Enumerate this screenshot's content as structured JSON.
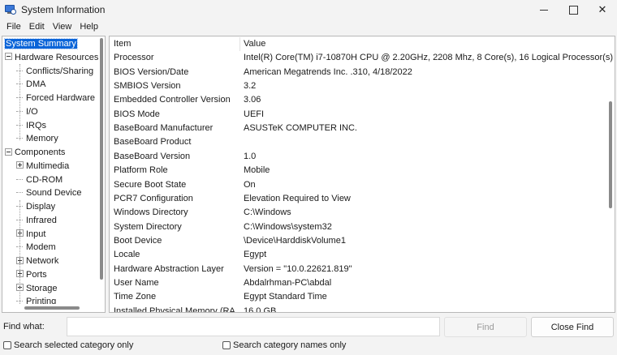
{
  "window": {
    "title": "System Information",
    "icon": "system-info-icon"
  },
  "menu": [
    "File",
    "Edit",
    "View",
    "Help"
  ],
  "tree": {
    "items": [
      {
        "label": "System Summary",
        "level": 0,
        "selected": true,
        "expander": "none"
      },
      {
        "label": "Hardware Resources",
        "level": 0,
        "expander": "minus"
      },
      {
        "label": "Conflicts/Sharing",
        "level": 1,
        "expander": "none"
      },
      {
        "label": "DMA",
        "level": 1,
        "expander": "none"
      },
      {
        "label": "Forced Hardware",
        "level": 1,
        "expander": "none"
      },
      {
        "label": "I/O",
        "level": 1,
        "expander": "none"
      },
      {
        "label": "IRQs",
        "level": 1,
        "expander": "none"
      },
      {
        "label": "Memory",
        "level": 1,
        "expander": "none"
      },
      {
        "label": "Components",
        "level": 0,
        "expander": "minus"
      },
      {
        "label": "Multimedia",
        "level": 1,
        "expander": "plus"
      },
      {
        "label": "CD-ROM",
        "level": 1,
        "expander": "none"
      },
      {
        "label": "Sound Device",
        "level": 1,
        "expander": "none"
      },
      {
        "label": "Display",
        "level": 1,
        "expander": "none"
      },
      {
        "label": "Infrared",
        "level": 1,
        "expander": "none"
      },
      {
        "label": "Input",
        "level": 1,
        "expander": "plus"
      },
      {
        "label": "Modem",
        "level": 1,
        "expander": "none"
      },
      {
        "label": "Network",
        "level": 1,
        "expander": "plus"
      },
      {
        "label": "Ports",
        "level": 1,
        "expander": "plus"
      },
      {
        "label": "Storage",
        "level": 1,
        "expander": "plus"
      },
      {
        "label": "Printing",
        "level": 1,
        "expander": "none"
      }
    ]
  },
  "list": {
    "headers": [
      "Item",
      "Value"
    ],
    "rows": [
      [
        "Processor",
        "Intel(R) Core(TM) i7-10870H CPU @ 2.20GHz, 2208 Mhz, 8 Core(s), 16 Logical Processor(s)"
      ],
      [
        "BIOS Version/Date",
        "American Megatrends Inc.            .310, 4/18/2022"
      ],
      [
        "SMBIOS Version",
        "3.2"
      ],
      [
        "Embedded Controller Version",
        "3.06"
      ],
      [
        "BIOS Mode",
        "UEFI"
      ],
      [
        "BaseBoard Manufacturer",
        "ASUSTeK COMPUTER INC."
      ],
      [
        "BaseBoard Product",
        ""
      ],
      [
        "BaseBoard Version",
        "1.0"
      ],
      [
        "Platform Role",
        "Mobile"
      ],
      [
        "Secure Boot State",
        "On"
      ],
      [
        "PCR7 Configuration",
        "Elevation Required to View"
      ],
      [
        "Windows Directory",
        "C:\\Windows"
      ],
      [
        "System Directory",
        "C:\\Windows\\system32"
      ],
      [
        "Boot Device",
        "\\Device\\HarddiskVolume1"
      ],
      [
        "Locale",
        "Egypt"
      ],
      [
        "Hardware Abstraction Layer",
        "Version = \"10.0.22621.819\""
      ],
      [
        "User Name",
        "Abdalrhman-PC\\abdal"
      ],
      [
        "Time Zone",
        "Egypt Standard Time"
      ],
      [
        "Installed Physical Memory (RA",
        "16.0 GB"
      ]
    ]
  },
  "find": {
    "label": "Find what:",
    "value": "",
    "find_button": "Find",
    "close_button": "Close Find",
    "check_selected": "Search selected category only",
    "check_names": "Search category names only"
  }
}
